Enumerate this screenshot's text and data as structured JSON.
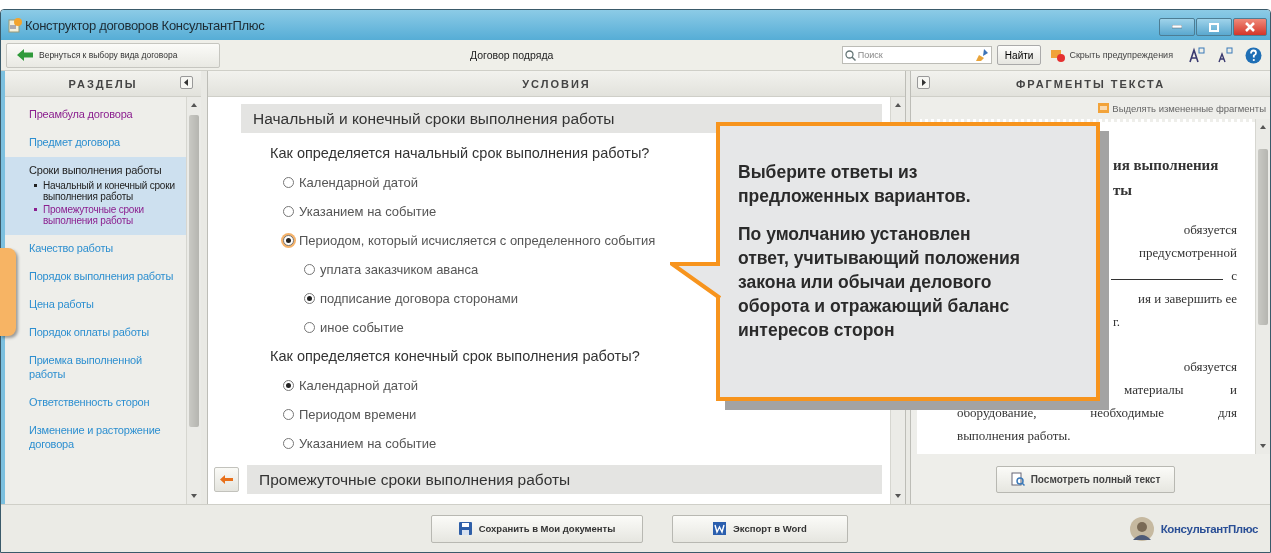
{
  "window": {
    "title": "Конструктор договоров КонсультантПлюс"
  },
  "toolbar": {
    "back_button": "Вернуться к выбору вида договора",
    "document_title": "Договор подряда",
    "search": {
      "placeholder": "Поиск"
    },
    "find_button": "Найти",
    "hide_warnings": "Скрыть предупреждения"
  },
  "sidebar": {
    "header": "РАЗДЕЛЫ",
    "items": [
      {
        "label": "Преамбула договора",
        "selected": false,
        "visited": true
      },
      {
        "label": "Предмет договора",
        "selected": false,
        "visited": false
      },
      {
        "label": "Сроки выполнения работы",
        "selected": true,
        "visited": false,
        "children": [
          {
            "label": "Начальный и конечный сроки выполнения работы",
            "selected": true,
            "visited": false
          },
          {
            "label": "Промежуточные сроки выполнения работы",
            "selected": false,
            "visited": true
          }
        ]
      },
      {
        "label": "Качество работы",
        "selected": false,
        "visited": false
      },
      {
        "label": "Порядок выполнения работы",
        "selected": false,
        "visited": false
      },
      {
        "label": "Цена работы",
        "selected": false,
        "visited": false
      },
      {
        "label": "Порядок оплаты работы",
        "selected": false,
        "visited": false
      },
      {
        "label": "Приемка выполненной работы",
        "selected": false,
        "visited": false
      },
      {
        "label": "Ответственность сторон",
        "selected": false,
        "visited": false
      },
      {
        "label": "Изменение и расторжение договора",
        "selected": false,
        "visited": false
      }
    ]
  },
  "conditions": {
    "header": "УСЛОВИЯ",
    "sections": [
      {
        "title": "Начальный и конечный сроки выполнения работы",
        "expanded": true,
        "questions": [
          {
            "text": "Как определяется начальный срок выполнения работы?",
            "options": [
              {
                "label": "Календарной датой",
                "selected": false,
                "focused": false
              },
              {
                "label": "Указанием на событие",
                "selected": false,
                "focused": false
              },
              {
                "label": "Периодом, который исчисляется с определенного события",
                "selected": true,
                "focused": true,
                "children": [
                  {
                    "label": "уплата заказчиком аванса",
                    "selected": false,
                    "focused": false
                  },
                  {
                    "label": "подписание договора сторонами",
                    "selected": true,
                    "focused": false
                  },
                  {
                    "label": "иное событие",
                    "selected": false,
                    "focused": false
                  }
                ]
              }
            ]
          },
          {
            "text": "Как определяется конечный срок выполнения работы?",
            "options": [
              {
                "label": "Календарной датой",
                "selected": true,
                "focused": false
              },
              {
                "label": "Периодом времени",
                "selected": false,
                "focused": false
              },
              {
                "label": "Указанием на событие",
                "selected": false,
                "focused": false
              }
            ]
          }
        ]
      },
      {
        "title": "Промежуточные сроки выполнения работы",
        "expanded": false
      }
    ]
  },
  "fragments": {
    "header": "ФРАГМЕНТЫ ТЕКСТА",
    "highlight_toggle": "Выделять измененные фрагменты",
    "lines": [
      {
        "kind": "heading",
        "text": "ия выполнения"
      },
      {
        "kind": "heading",
        "text": "ты"
      },
      {
        "kind": "right",
        "text": "обязуется"
      },
      {
        "kind": "right",
        "text": "предусмотренной"
      },
      {
        "kind": "blank",
        "text": "с"
      },
      {
        "kind": "right",
        "text": "ия и завершить ее"
      },
      {
        "kind": "tail",
        "text": "г."
      },
      {
        "kind": "gap"
      },
      {
        "kind": "right",
        "text": "обязуется"
      },
      {
        "kind": "justify-right",
        "text": "материалы и"
      },
      {
        "kind": "justify",
        "text": "оборудование, необходимые для"
      },
      {
        "kind": "left",
        "text": "выполнения работы."
      }
    ],
    "view_full_button": "Посмотреть полный текст"
  },
  "footer": {
    "buttons": [
      {
        "label": "Сохранить в Мои документы",
        "kind": "save"
      },
      {
        "label": "Экспорт в Word",
        "kind": "word"
      }
    ],
    "logo": "КонсультантПлюс"
  },
  "callout": {
    "paragraphs": [
      "Выберите ответы из\nпредложенных вариантов.",
      "По умолчанию установлен\nответ, учитывающий положения\nзакона или обычаи делового\nоборота и отражающий баланс\nинтересов сторон"
    ]
  }
}
